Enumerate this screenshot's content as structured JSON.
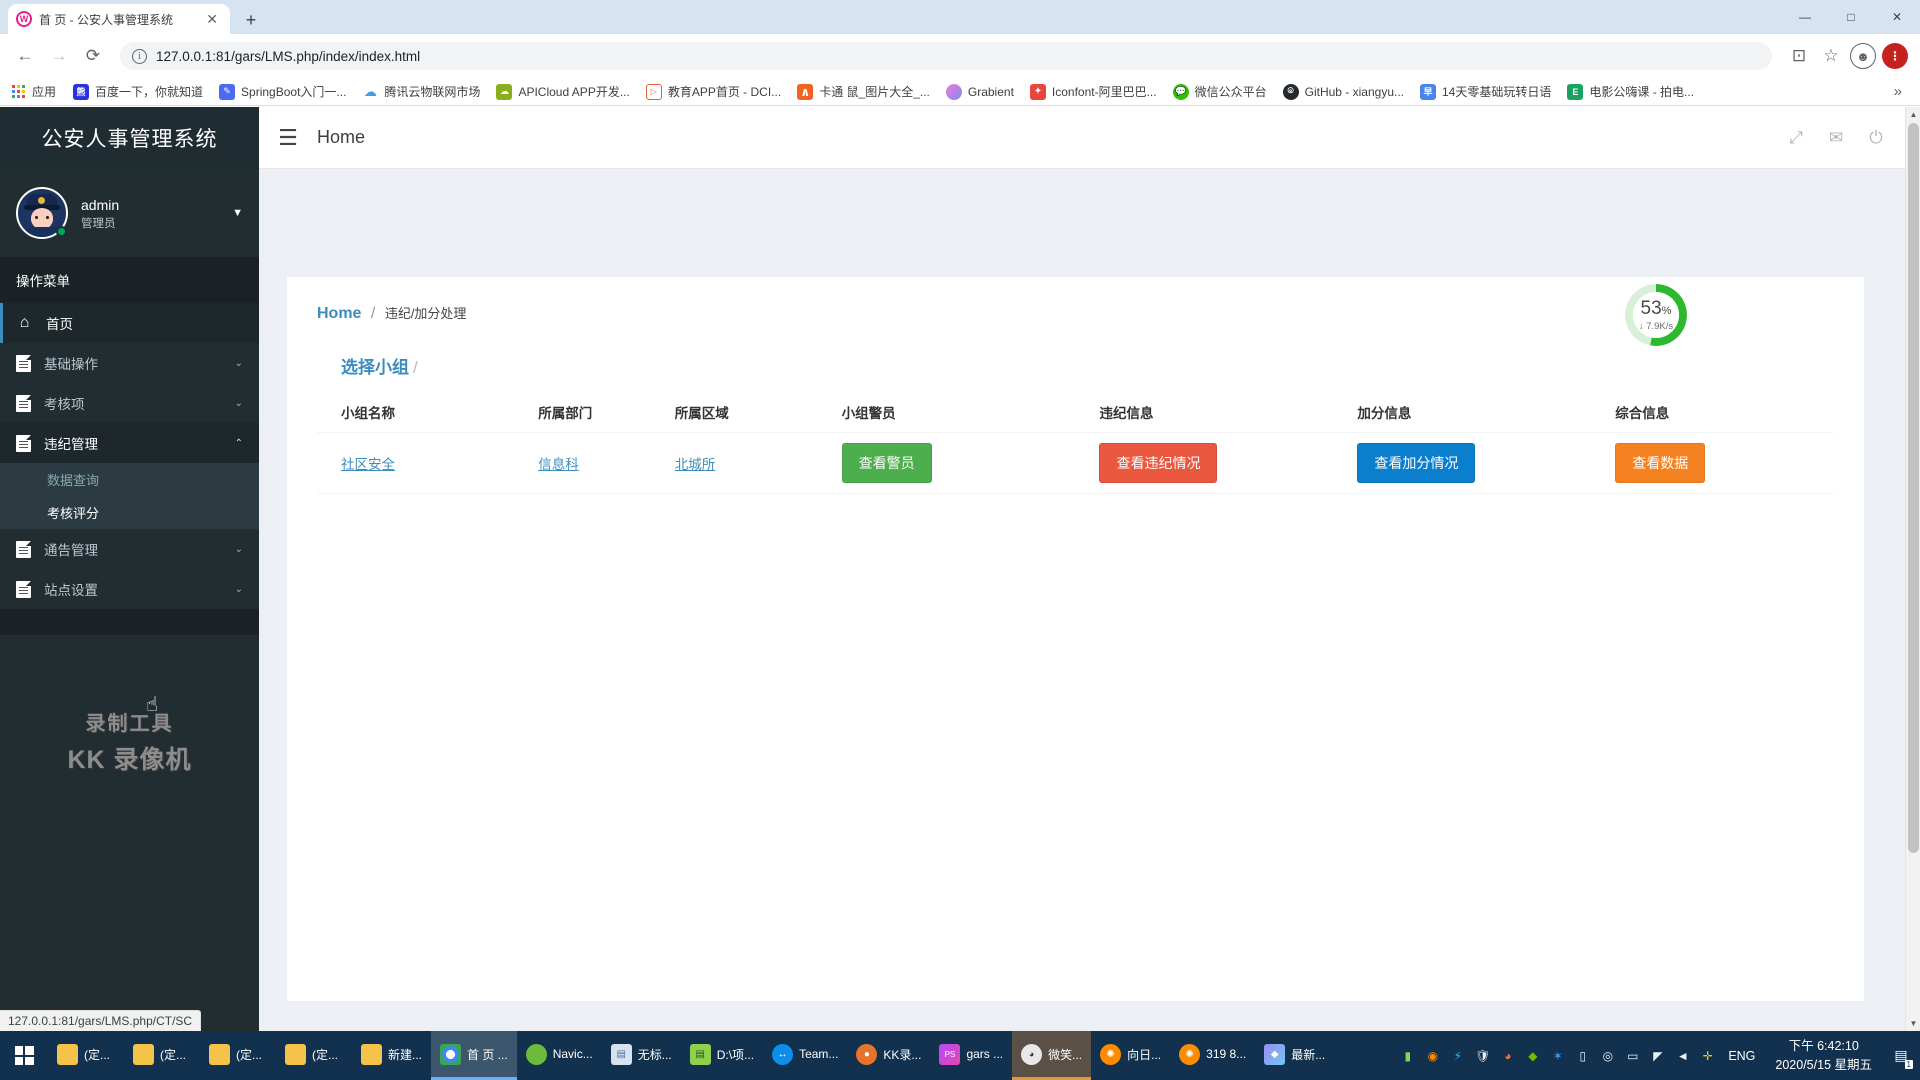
{
  "browser": {
    "tab": {
      "title": "首 页 - 公安人事管理系统",
      "favicon_letter": "W",
      "close_label": "✕"
    },
    "new_tab_label": "+",
    "window_buttons": {
      "minimize": "—",
      "maximize": "□",
      "close": "✕"
    },
    "nav": {
      "back": "←",
      "forward": "→",
      "reload": "⟳",
      "url": "127.0.0.1:81/gars/LMS.php/index/index.html",
      "info_icon": "i",
      "cast": "⊡",
      "star": "☆",
      "profile_letter": "●"
    },
    "bookmarks_bar": {
      "apps_label": "应用",
      "overflow_label": "»",
      "items": [
        {
          "label": "百度一下，你就知道",
          "icon": "baidu-icon",
          "color": "#2932e1",
          "glyph": "熊"
        },
        {
          "label": "SpringBoot入门一...",
          "icon": "springboot-icon",
          "color": "#3b5bdb",
          "glyph": "✎"
        },
        {
          "label": "腾讯云物联网市场",
          "icon": "tencent-cloud-icon",
          "color": "#3e9cf0",
          "glyph": "☁"
        },
        {
          "label": "APICloud APP开发...",
          "icon": "apicloud-icon",
          "color": "#8aad1d",
          "glyph": "☁"
        },
        {
          "label": "教育APP首页 - DCI...",
          "icon": "dci-icon",
          "color": "#ffffff",
          "glyph": "▷"
        },
        {
          "label": "卡通 鼠_图片大全_...",
          "icon": "image-search-icon",
          "color": "#f26322",
          "glyph": "∧"
        },
        {
          "label": "Grabient",
          "icon": "grabient-icon",
          "color": "#a06bd8",
          "glyph": "●"
        },
        {
          "label": "Iconfont-阿里巴巴...",
          "icon": "iconfont-icon",
          "color": "#e8453c",
          "glyph": "✦"
        },
        {
          "label": "微信公众平台",
          "icon": "wechat-icon",
          "color": "#2dc100",
          "glyph": "✆"
        },
        {
          "label": "GitHub - xiangyu...",
          "icon": "github-icon",
          "color": "#24292e",
          "glyph": "●"
        },
        {
          "label": "14天零基础玩转日语",
          "icon": "japanese-course-icon",
          "color": "#4a86e8",
          "glyph": "早"
        },
        {
          "label": "电影公嗨课 - 拍电...",
          "icon": "movie-course-icon",
          "color": "#1aa260",
          "glyph": "E"
        }
      ]
    },
    "status_bar_url": "127.0.0.1:81/gars/LMS.php/CT/SC"
  },
  "app": {
    "brand": "公安人事管理系统",
    "user": {
      "name": "admin",
      "role": "管理员",
      "caret": "▼",
      "avatar": "police-officer-avatar"
    },
    "menu_header": "操作菜单",
    "menu": [
      {
        "label": "首页",
        "icon": "home-icon",
        "state": "active",
        "arrow": ""
      },
      {
        "label": "基础操作",
        "icon": "doc-icon",
        "state": "normal",
        "arrow": "⌄"
      },
      {
        "label": "考核项",
        "icon": "doc-icon",
        "state": "normal",
        "arrow": "⌄"
      },
      {
        "label": "违纪管理",
        "icon": "doc-icon",
        "state": "open",
        "arrow": "⌃"
      },
      {
        "label": "通告管理",
        "icon": "doc-icon",
        "state": "normal",
        "arrow": "⌄"
      },
      {
        "label": "站点设置",
        "icon": "doc-icon",
        "state": "normal",
        "arrow": "⌄"
      }
    ],
    "submenu": [
      {
        "label": "数据查询",
        "selected": false
      },
      {
        "label": "考核评分",
        "selected": true
      }
    ],
    "watermark": {
      "line1": "录制工具",
      "line2": "KK 录像机"
    },
    "topbar": {
      "hamburger": "☰",
      "title": "Home",
      "icons": [
        {
          "name": "fullscreen-icon",
          "glyph": "⤢"
        },
        {
          "name": "mail-icon",
          "glyph": "✉"
        },
        {
          "name": "power-icon",
          "glyph": "⏻"
        }
      ]
    },
    "breadcrumb": {
      "home": "Home",
      "separator": "/",
      "current": "违纪/加分处理"
    },
    "panel": {
      "title": "选择小组",
      "title_suffix": "/"
    },
    "table": {
      "headers": [
        "小组名称",
        "所属部门",
        "所属区域",
        "小组警员",
        "违纪信息",
        "加分信息",
        "综合信息"
      ],
      "rows": [
        {
          "group_name": "社区安全",
          "department": "信息科",
          "area": "北城所",
          "officers_btn": "查看警员",
          "violation_btn": "查看违纪情况",
          "bonus_btn": "查看加分情况",
          "summary_btn": "查看数据"
        }
      ]
    },
    "colors": {
      "green": "#4cae4c",
      "red": "#e9573f",
      "blue": "#0b7fce",
      "orange": "#f58220",
      "link": "#3c8dbc"
    }
  },
  "net_widget": {
    "percent": "53",
    "percent_symbol": "%",
    "speed": "↓ 7.9K/s",
    "ring_color": "#2eb82e"
  },
  "taskbar": {
    "start": "windows-start-icon",
    "items": [
      {
        "label": "(定...",
        "icon": "folder-icon",
        "color": "#f5c24a",
        "glyph": "",
        "state": ""
      },
      {
        "label": "(定...",
        "icon": "folder-icon",
        "color": "#f5c24a",
        "glyph": "",
        "state": ""
      },
      {
        "label": "(定...",
        "icon": "folder-icon",
        "color": "#f5c24a",
        "glyph": "",
        "state": ""
      },
      {
        "label": "(定...",
        "icon": "folder-icon",
        "color": "#f5c24a",
        "glyph": "",
        "state": ""
      },
      {
        "label": "新建...",
        "icon": "folder-icon",
        "color": "#f5c24a",
        "glyph": "",
        "state": ""
      },
      {
        "label": "首 页 ...",
        "icon": "chrome-icon",
        "color": "#ffffff",
        "glyph": "◉",
        "state": "active"
      },
      {
        "label": "Navic...",
        "icon": "navicat-icon",
        "color": "#6cbb3c",
        "glyph": "N",
        "state": ""
      },
      {
        "label": "无标...",
        "icon": "notepad-icon",
        "color": "#d7e3f0",
        "glyph": "▤",
        "state": ""
      },
      {
        "label": "D:\\项...",
        "icon": "editor-icon",
        "color": "#8fd14f",
        "glyph": "▤",
        "state": ""
      },
      {
        "label": "Team...",
        "icon": "teamviewer-icon",
        "color": "#0e8ee9",
        "glyph": "↔",
        "state": ""
      },
      {
        "label": "KK录...",
        "icon": "kk-recorder-icon",
        "color": "#e8742c",
        "glyph": "●",
        "state": ""
      },
      {
        "label": "gars ...",
        "icon": "phpstorm-icon",
        "color": "#b74af7",
        "glyph": "PS",
        "state": ""
      },
      {
        "label": "微笑...",
        "icon": "qq-icon",
        "color": "#e8e8e8",
        "glyph": "🐧",
        "state": "active2"
      },
      {
        "label": "向日...",
        "icon": "sunflower-remote-icon",
        "color": "#ff8c00",
        "glyph": "✺",
        "state": ""
      },
      {
        "label": "319 8...",
        "icon": "sunflower-remote-icon",
        "color": "#ff8c00",
        "glyph": "✺",
        "state": ""
      },
      {
        "label": "最新...",
        "icon": "app-icon",
        "color": "#9b8cf0",
        "glyph": "◆",
        "state": ""
      }
    ],
    "tray": [
      {
        "name": "usb-icon",
        "glyph": "▮",
        "color": "#7ed957"
      },
      {
        "name": "orange-app-icon",
        "glyph": "◉",
        "color": "#ff8c00"
      },
      {
        "name": "thunder-icon",
        "glyph": "⚡",
        "color": "#2eb8ff"
      },
      {
        "name": "defender-icon",
        "glyph": "🛡",
        "color": "#ffffff"
      },
      {
        "name": "firefox-icon",
        "glyph": "◕",
        "color": "#ff7139"
      },
      {
        "name": "nvidia-icon",
        "glyph": "◆",
        "color": "#76b900"
      },
      {
        "name": "bluetooth-icon",
        "glyph": "✶",
        "color": "#2e9bff"
      },
      {
        "name": "safely-remove-icon",
        "glyph": "▯",
        "color": "#ffffff"
      },
      {
        "name": "disc-icon",
        "glyph": "◎",
        "color": "#e0e0e0"
      },
      {
        "name": "battery-icon",
        "glyph": "▭",
        "color": "#ffffff"
      },
      {
        "name": "wifi-icon",
        "glyph": "◤",
        "color": "#ffffff"
      },
      {
        "name": "volume-icon",
        "glyph": "◄",
        "color": "#ffffff"
      },
      {
        "name": "update-icon",
        "glyph": "✛",
        "color": "#f5c518"
      }
    ],
    "language": "ENG",
    "clock": {
      "time": "下午 6:42:10",
      "date": "2020/5/15 星期五"
    },
    "notification": {
      "glyph": "▤",
      "badge": "1"
    }
  }
}
